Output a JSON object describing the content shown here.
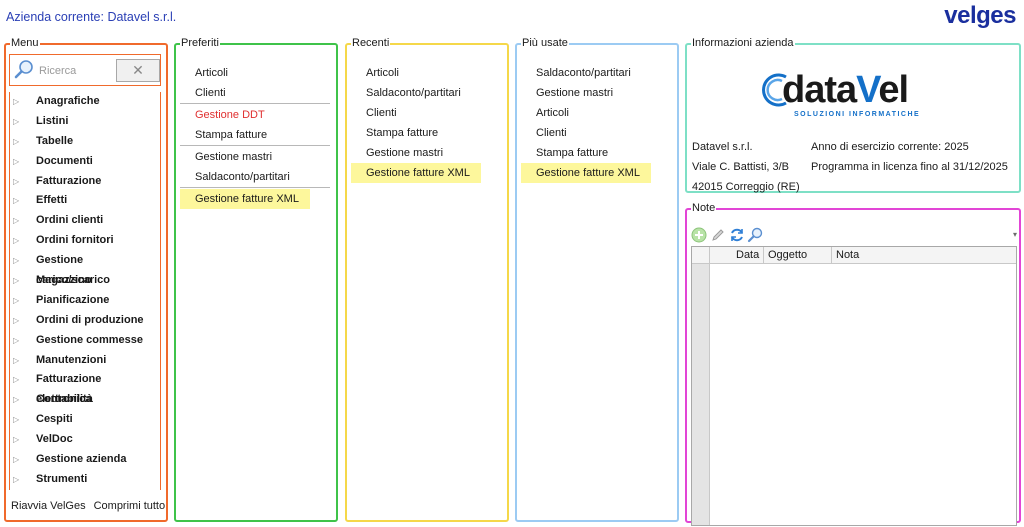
{
  "header": {
    "company_label": "Azienda corrente: Datavel s.r.l.",
    "logo_part1": "vel",
    "logo_part2": "ges"
  },
  "menu": {
    "legend": "Menu",
    "search_placeholder": "Ricerca",
    "clear_label": "✕",
    "items": [
      "Anagrafiche",
      "Listini",
      "Tabelle",
      "Documenti",
      "Fatturazione",
      "Effetti",
      "Ordini clienti",
      "Ordini fornitori",
      "Gestione carico/scarico",
      "Magazzino",
      "Pianificazione",
      "Ordini di produzione",
      "Gestione commesse",
      "Manutenzioni",
      "Fatturazione elettronica",
      "Contabilità",
      "Cespiti",
      "VelDoc",
      "Gestione azienda",
      "Strumenti"
    ],
    "footer_restart": "Riavvia VelGes",
    "footer_collapse": "Comprimi tutto"
  },
  "preferiti": {
    "legend": "Preferiti",
    "items": [
      "Articoli",
      "Clienti",
      "Gestione DDT",
      "Stampa fatture",
      "Gestione mastri",
      "Saldaconto/partitari",
      "Gestione fatture XML"
    ]
  },
  "recenti": {
    "legend": "Recenti",
    "items": [
      "Articoli",
      "Saldaconto/partitari",
      "Clienti",
      "Stampa fatture",
      "Gestione mastri",
      "Gestione fatture XML"
    ]
  },
  "piu_usate": {
    "legend": "Più usate",
    "items": [
      "Saldaconto/partitari",
      "Gestione mastri",
      "Articoli",
      "Clienti",
      "Stampa fatture",
      "Gestione fatture XML"
    ]
  },
  "info": {
    "legend": "Informazioni azienda",
    "logo_word_a": "data",
    "logo_word_v": "V",
    "logo_word_b": "el",
    "logo_tagline": "SOLUZIONI INFORMATICHE",
    "company_name": "Datavel s.r.l.",
    "address": "Viale C. Battisti, 3/B",
    "city": "42015 Correggio (RE)",
    "fiscal_year": "Anno di esercizio corrente: 2025",
    "license": "Programma in licenza fino al 31/12/2025"
  },
  "note": {
    "legend": "Note",
    "columns": [
      "Data",
      "Oggetto",
      "Nota"
    ]
  },
  "colors": {
    "menu": "#f06a2c",
    "preferiti": "#3fc34a",
    "recenti": "#f5d84a",
    "piu_usate": "#9ccbf3",
    "info": "#7ee0c6",
    "note": "#e245d6",
    "highlight": "#fdf79c"
  }
}
